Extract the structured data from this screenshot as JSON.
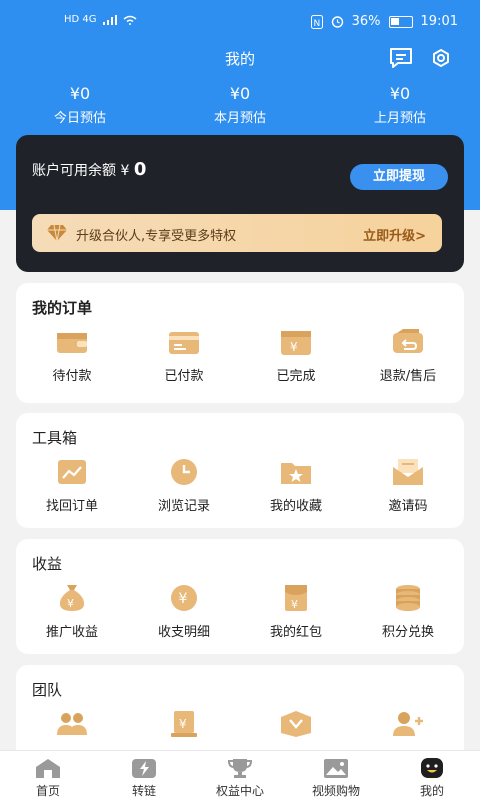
{
  "status_bar": {
    "left_text": "HD 4G",
    "battery": "36%",
    "time": "19:01"
  },
  "header": {
    "title": "我的",
    "stats": [
      {
        "value": "¥0",
        "label": "今日预估"
      },
      {
        "value": "¥0",
        "label": "本月预估"
      },
      {
        "value": "¥0",
        "label": "上月预估"
      }
    ]
  },
  "balance": {
    "label": "账户可用余额 ¥",
    "amount": "0",
    "withdraw_label": "立即提现",
    "upgrade_text": "升级合伙人,专享受更多特权",
    "upgrade_link": "立即升级>"
  },
  "orders": {
    "title": "我的订单",
    "items": [
      {
        "label": "待付款",
        "icon": "wallet-icon"
      },
      {
        "label": "已付款",
        "icon": "card-icon"
      },
      {
        "label": "已完成",
        "icon": "yen-card-icon"
      },
      {
        "label": "退款/售后",
        "icon": "refund-icon"
      }
    ]
  },
  "toolbox": {
    "title": "工具箱",
    "items": [
      {
        "label": "找回订单",
        "icon": "chart-icon"
      },
      {
        "label": "浏览记录",
        "icon": "clock-icon"
      },
      {
        "label": "我的收藏",
        "icon": "star-folder-icon"
      },
      {
        "label": "邀请码",
        "icon": "envelope-icon"
      }
    ]
  },
  "earnings": {
    "title": "收益",
    "items": [
      {
        "label": "推广收益",
        "icon": "money-bag-icon"
      },
      {
        "label": "收支明细",
        "icon": "coin-icon"
      },
      {
        "label": "我的红包",
        "icon": "red-packet-icon"
      },
      {
        "label": "积分兑换",
        "icon": "coin-stack-icon"
      }
    ]
  },
  "team": {
    "title": "团队",
    "items": [
      {
        "label": "",
        "icon": "team-icon"
      },
      {
        "label": "",
        "icon": "yen-trophy-icon"
      },
      {
        "label": "",
        "icon": "heart-box-icon"
      },
      {
        "label": "",
        "icon": "add-user-icon"
      }
    ]
  },
  "tabbar": {
    "items": [
      {
        "label": "首页",
        "icon": "home-icon"
      },
      {
        "label": "转链",
        "icon": "lightning-icon"
      },
      {
        "label": "权益中心",
        "icon": "trophy-icon"
      },
      {
        "label": "视频购物",
        "icon": "image-icon"
      },
      {
        "label": "我的",
        "icon": "face-icon"
      }
    ]
  },
  "colors": {
    "primary": "#2e8ff0",
    "card_dark": "#1f2329",
    "gold": "#e0b06a"
  }
}
